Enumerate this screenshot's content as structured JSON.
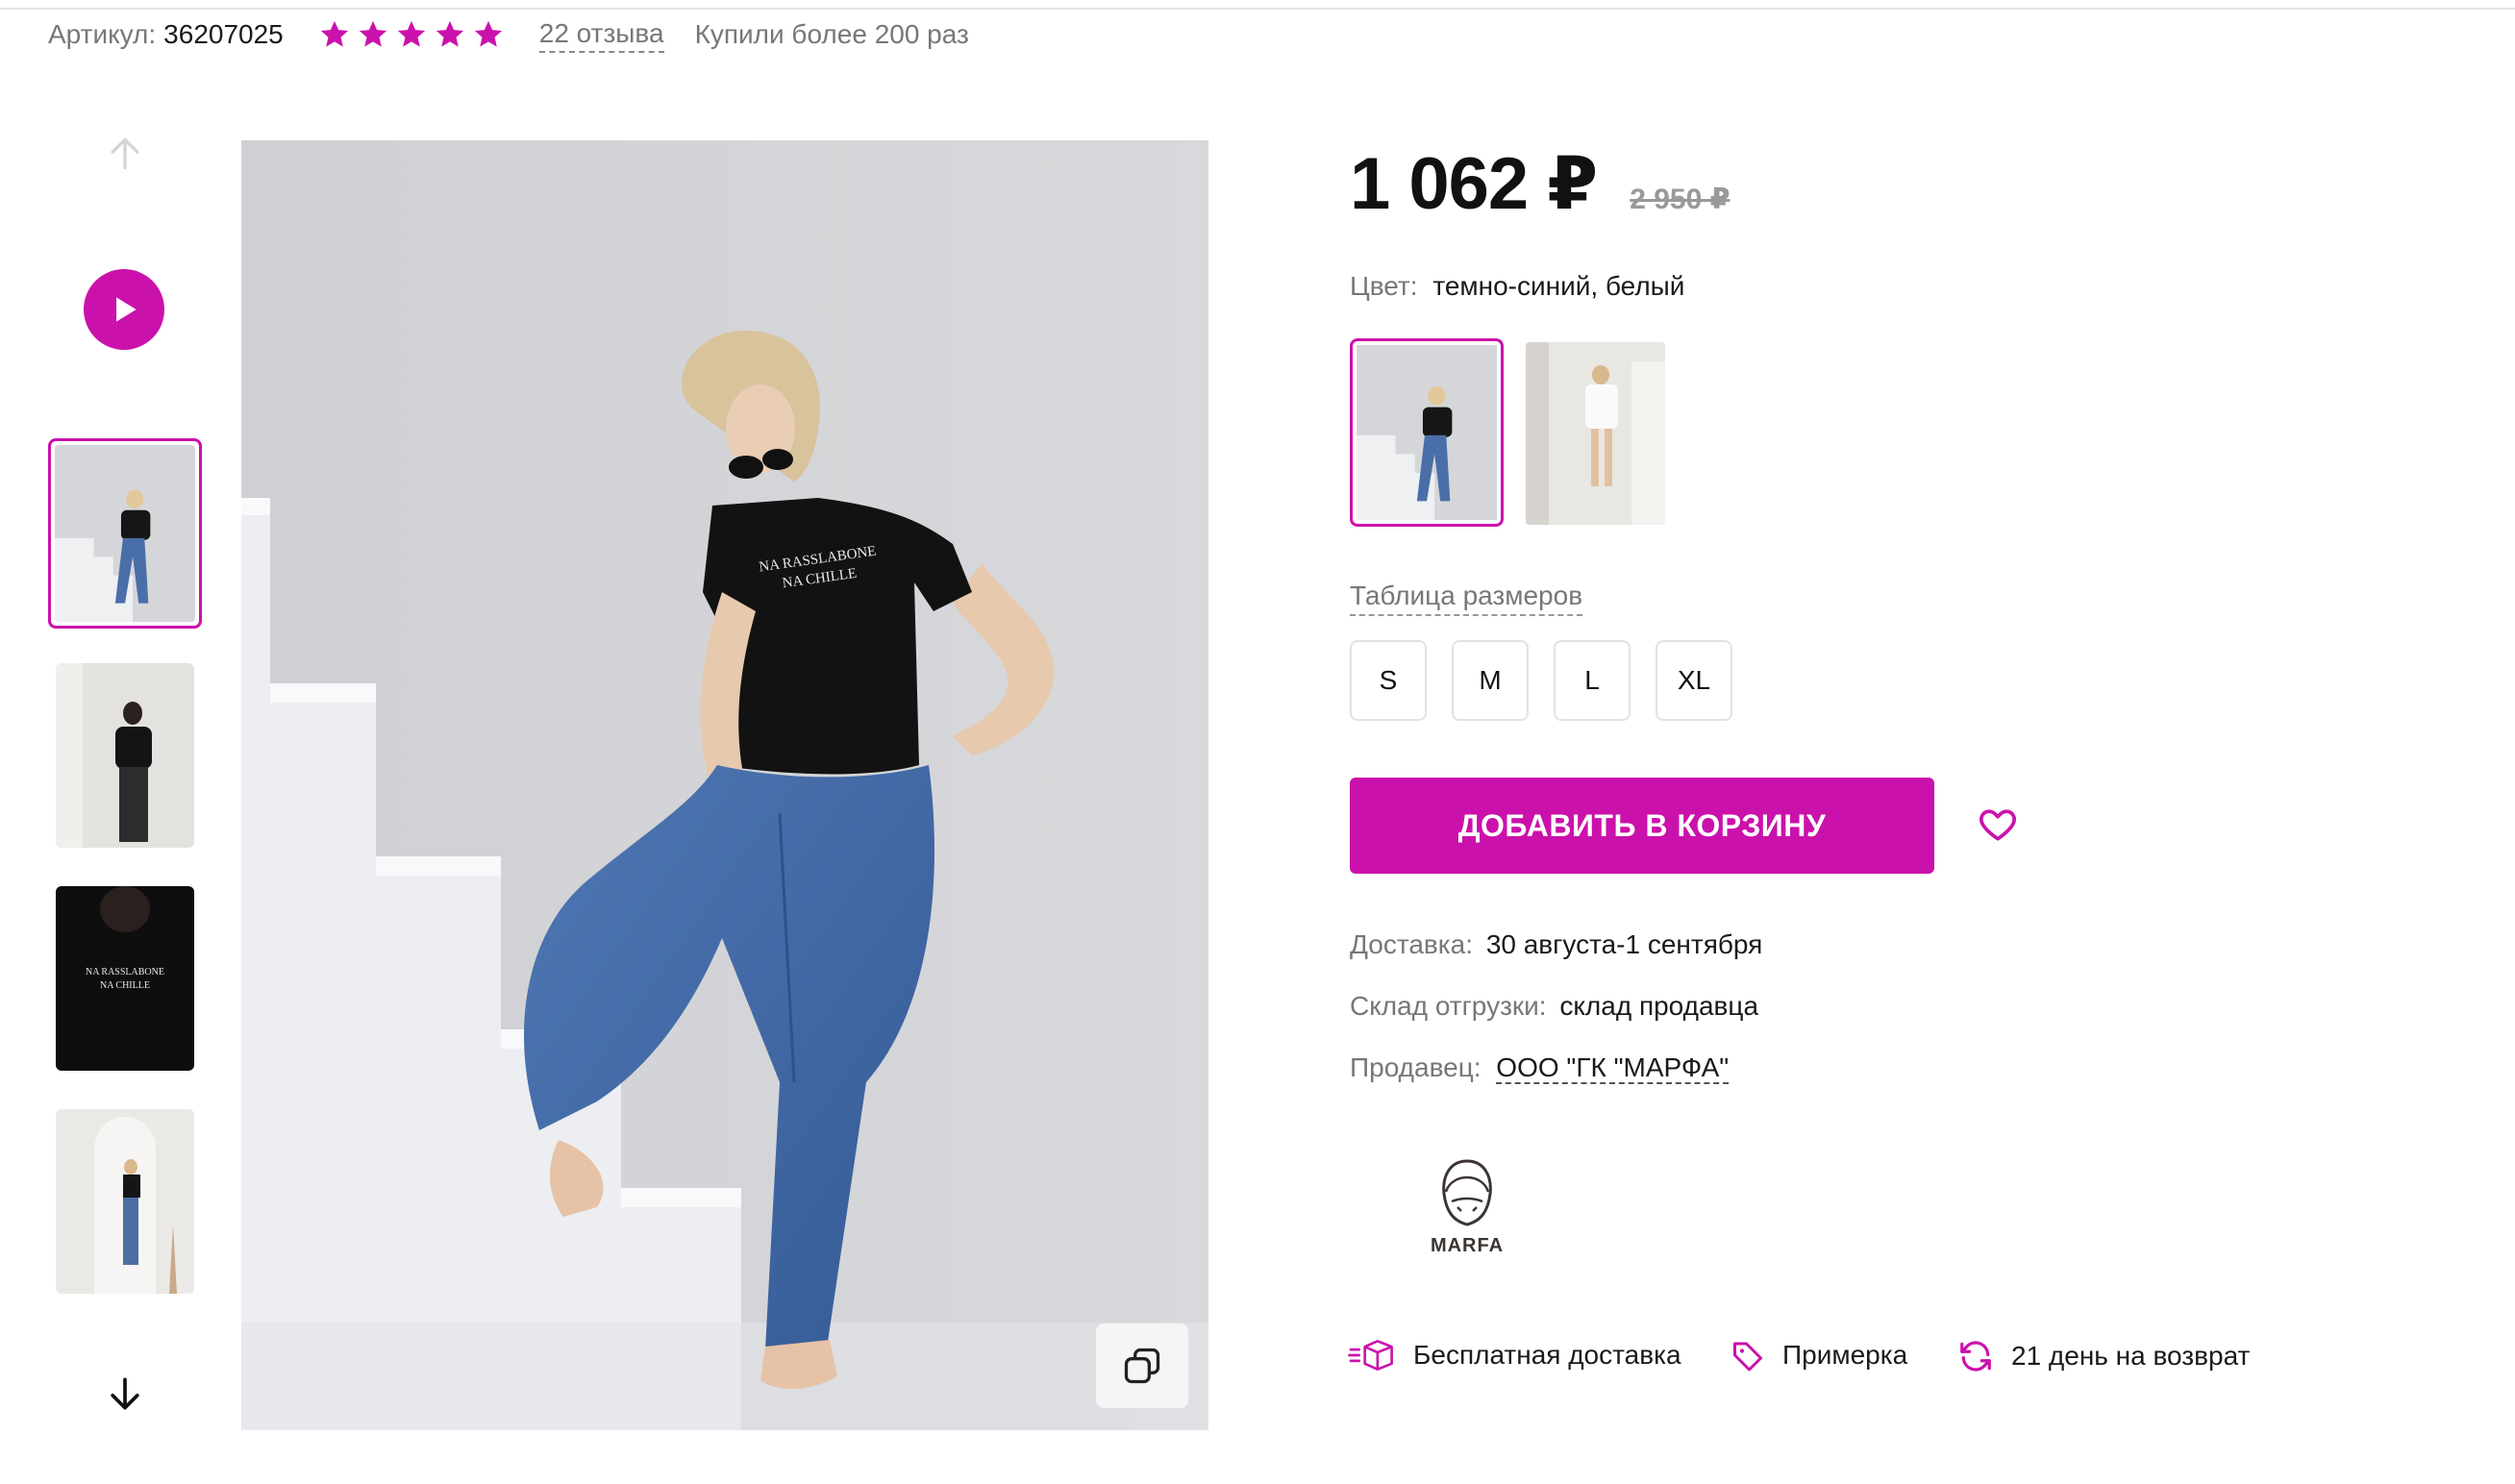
{
  "header": {
    "sku_label": "Артикул:",
    "sku_value": "36207025",
    "rating": 5,
    "reviews_link": "22 отзыва",
    "bought_text": "Купили более 200 раз"
  },
  "gallery": {
    "thumbnails": [
      "thumb-1",
      "thumb-2",
      "thumb-3",
      "thumb-4"
    ],
    "selected_index": 0,
    "main_image_print": [
      "NA RASSLABONE",
      "NA CHILLE"
    ]
  },
  "product": {
    "price_now": "1 062 ₽",
    "price_old": "2 950 ₽",
    "color_label": "Цвет:",
    "color_value": "темно-синий, белый",
    "size_table_link": "Таблица размеров",
    "sizes": [
      "S",
      "M",
      "L",
      "XL"
    ],
    "add_to_cart": "ДОБАВИТЬ В КОРЗИНУ",
    "delivery_label": "Доставка:",
    "delivery_value": "30 августа-1 сентября",
    "warehouse_label": "Склад отгрузки:",
    "warehouse_value": "склад продавца",
    "seller_label": "Продавец:",
    "seller_value": "ООО \"ГК \"МАРФА\"",
    "brand_logo_text": "MARFA"
  },
  "features": {
    "free_delivery": "Бесплатная доставка",
    "fitting": "Примерка",
    "return": "21 день на возврат"
  },
  "colors": {
    "accent": "#cb11ab",
    "muted_text": "#777777",
    "text": "#1a1a1a"
  },
  "icons": [
    "arrow-up-icon",
    "play-icon",
    "arrow-down-icon",
    "star-icon",
    "heart-icon",
    "zoom-icon",
    "box-icon",
    "tag-icon",
    "refresh-icon"
  ]
}
